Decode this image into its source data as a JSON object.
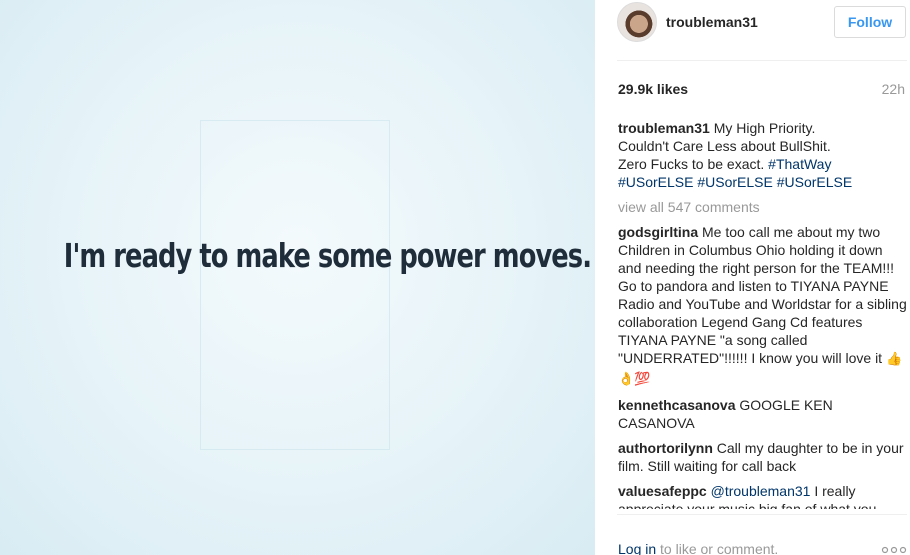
{
  "media": {
    "quote": "I'm ready to make some power moves."
  },
  "post": {
    "username": "troubleman31",
    "follow_label": "Follow",
    "likes": "29.9k likes",
    "time": "22h"
  },
  "caption": {
    "user": "troubleman31",
    "line1": " My High Priority.",
    "line2": "Couldn't Care Less about BullShit.",
    "line3": "Zero Fucks to be exact. ",
    "hashtags": [
      "#ThatWay",
      "#USorELSE",
      "#USorELSE",
      "#USorELSE"
    ]
  },
  "view_all": "view all 547 comments",
  "comments": [
    {
      "user": "godsgirltina",
      "text": " Me too call me about my two Children in Columbus Ohio holding it down and needing the right person for the TEAM!!! Go to pandora and listen to TIYANA PAYNE Radio and YouTube and Worldstar for a sibling collaboration Legend Gang Cd features TIYANA PAYNE \"a song called \"UNDERRATED\"!!!!!! I know you will love it ",
      "emoji": "👍👌💯"
    },
    {
      "user": "kennethcasanova",
      "text": " GOOGLE KEN CASANOVA"
    },
    {
      "user": "authortorilynn",
      "text": " Call my daughter to be in your film. Still waiting for call back"
    },
    {
      "user": "valuesafeppc",
      "mention": "@troubleman31",
      "text": " I really appreciate your music big fan of what you"
    }
  ],
  "footer": {
    "login_label": "Log in",
    "login_suffix": " to like or comment."
  }
}
